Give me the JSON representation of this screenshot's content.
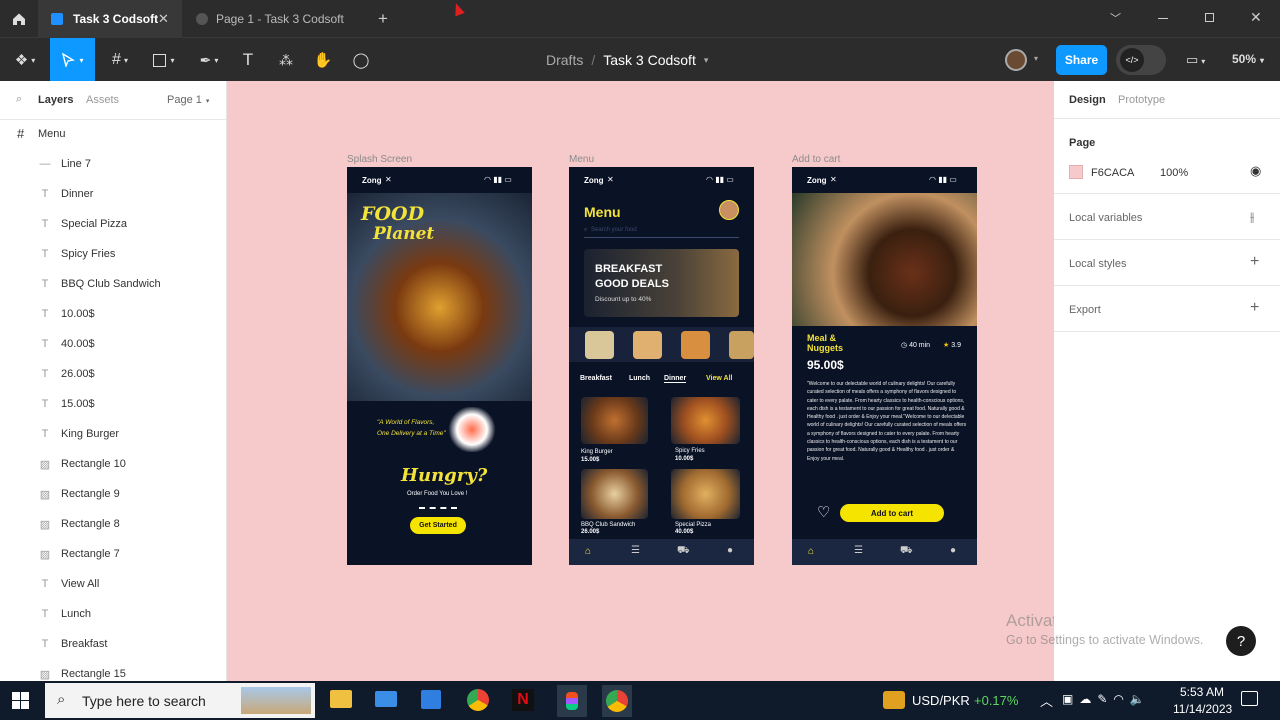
{
  "tabs": [
    {
      "label": "Task 3 Codsoft"
    },
    {
      "label": "Page 1 - Task 3 Codsoft"
    }
  ],
  "toolbar": {
    "breadcrumb_parent": "Drafts",
    "breadcrumb_sep": "/",
    "file_name": "Task 3 Codsoft",
    "share_label": "Share",
    "zoom": "50%"
  },
  "left_panel": {
    "tab_layers": "Layers",
    "tab_assets": "Assets",
    "page_selector": "Page 1",
    "frame_name": "Menu",
    "layers": [
      {
        "label": "Line 7",
        "icon": "line-icon"
      },
      {
        "label": "Dinner",
        "icon": "text-icon"
      },
      {
        "label": "Special Pizza",
        "icon": "text-icon"
      },
      {
        "label": "Spicy Fries",
        "icon": "text-icon"
      },
      {
        "label": "BBQ Club Sandwich",
        "icon": "text-icon"
      },
      {
        "label": "10.00$",
        "icon": "text-icon"
      },
      {
        "label": "40.00$",
        "icon": "text-icon"
      },
      {
        "label": "26.00$",
        "icon": "text-icon"
      },
      {
        "label": "15.00$",
        "icon": "text-icon"
      },
      {
        "label": "King Burger",
        "icon": "text-icon"
      },
      {
        "label": "Rectangle 10",
        "icon": "image-icon"
      },
      {
        "label": "Rectangle 9",
        "icon": "image-icon"
      },
      {
        "label": "Rectangle 8",
        "icon": "image-icon"
      },
      {
        "label": "Rectangle 7",
        "icon": "image-icon"
      },
      {
        "label": "View All",
        "icon": "text-icon"
      },
      {
        "label": "Lunch",
        "icon": "text-icon"
      },
      {
        "label": "Breakfast",
        "icon": "text-icon"
      },
      {
        "label": "Rectangle 15",
        "icon": "image-icon"
      }
    ]
  },
  "right_panel": {
    "tab_design": "Design",
    "tab_prototype": "Prototype",
    "page_heading": "Page",
    "page_color": "F6CACA",
    "page_opacity": "100%",
    "local_variables": "Local variables",
    "local_styles": "Local styles",
    "export": "Export"
  },
  "canvas": {
    "bg_color": "#f6caca",
    "frames": {
      "splash": "Splash Screen",
      "menu": "Menu",
      "cart": "Add to cart"
    },
    "carrier": "Zong",
    "splash": {
      "title1": "FOOD",
      "title2": "Planet",
      "quote": "\"A World of Flavors, One Delivery at a Time\"",
      "hungry": "Hungry?",
      "sub": "Order Food You Love !",
      "btn": "Get Started"
    },
    "menu": {
      "title": "Menu",
      "search": "Search your food",
      "banner1": "BREAKFAST",
      "banner2": "GOOD DEALS",
      "banner3": "Discount up to 40%",
      "cat1": "Breakfast",
      "cat2": "Lunch",
      "cat3": "Dinner",
      "view_all": "View All",
      "items": [
        {
          "name": "King Burger",
          "price": "15.00$"
        },
        {
          "name": "Spicy Fries",
          "price": "10.00$"
        },
        {
          "name": "BBQ Club Sandwich",
          "price": "26.00$"
        },
        {
          "name": "Special Pizza",
          "price": "40.00$"
        }
      ]
    },
    "cart": {
      "name1": "Meal &",
      "name2": "Nuggets",
      "time": "40 min",
      "rating": "3.9",
      "price": "95.00$",
      "desc": "\"Welcome to our delectable world of culinary delights! Our carefully curated selection of meals offers a symphony of flavors designed to cater to every palate. From hearty classics to health-conscious options, each dish is a testament to our passion for great food. Naturally good & Healthy food . just order & Enjoy your meal.\"Welcome to our delectable world of culinary delights! Our carefully curated selection of meals offers a symphony of flavors designed to cater to every palate. From hearty classics to health-conscious options, each dish is a testament to our passion for great food. Naturally good & Healthy food . just order & Enjoy your meal.",
      "btn": "Add to cart"
    }
  },
  "watermark": {
    "line1": "Activate Windows",
    "line2": "Go to Settings to activate Windows."
  },
  "help": "?",
  "taskbar": {
    "search": "Type here to search",
    "ticker": "USD/PKR",
    "change": "+0.17%",
    "time": "5:53 AM",
    "date": "11/14/2023"
  }
}
